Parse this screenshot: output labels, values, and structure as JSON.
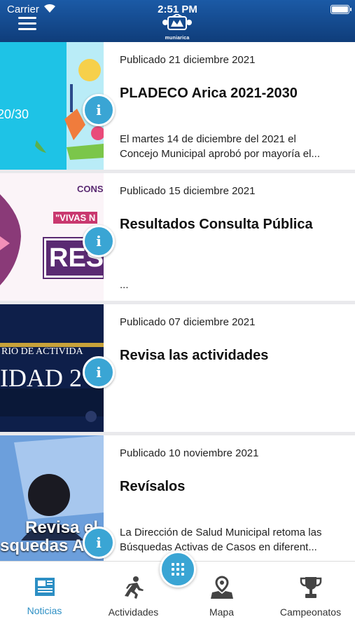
{
  "status_bar": {
    "carrier": "Carrier",
    "time": "2:51 PM"
  },
  "header": {
    "logo_text": "muniarica",
    "menu_icon": "hamburger-menu-icon"
  },
  "news": [
    {
      "published": "Publicado 21 diciembre 2021",
      "title": "PLADECO Arica 2021-2030",
      "desc_line1": "El martes 14 de diciembre del 2021 el",
      "desc_line2": "Concejo Municipal aprobó por mayoría el...",
      "thumb_text": "20/30"
    },
    {
      "published": "Publicado 15 diciembre 2021",
      "title": "Resultados Consulta Pública",
      "desc_line1": "",
      "desc_line2": "...",
      "thumb_text_1": "CONS",
      "thumb_text_2": "\"VIVAS N",
      "thumb_text_3": "RES"
    },
    {
      "published": "Publicado 07 diciembre 2021",
      "title": "Revisa las actividades",
      "desc_line1": "",
      "desc_line2": "",
      "thumb_text_1": "RIO DE ACTIVIDA",
      "thumb_text_2": "IDAD 2"
    },
    {
      "published": "Publicado 10 noviembre 2021",
      "title": "Revísalos",
      "desc_line1": "La Dirección de Salud Municipal retoma las",
      "desc_line2": "Búsquedas Activas de Casos en diferent...",
      "thumb_text_1": "Revisa el",
      "thumb_text_2": "squedas Act"
    }
  ],
  "info_badge": "i",
  "tabs": [
    {
      "label": "Noticias",
      "icon": "newspaper-icon",
      "active": true
    },
    {
      "label": "Actividades",
      "icon": "runner-icon",
      "active": false
    },
    {
      "label": "Mapa",
      "icon": "map-pin-icon",
      "active": false
    },
    {
      "label": "Campeonatos",
      "icon": "trophy-icon",
      "active": false
    }
  ],
  "colors": {
    "header": "#1b5aa6",
    "accent": "#3aa5d4",
    "active_tab": "#2d8fc4"
  }
}
